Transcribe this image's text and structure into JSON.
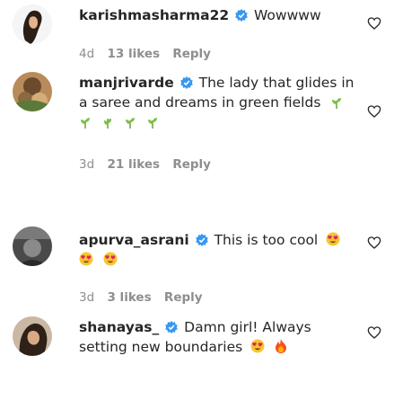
{
  "comments": [
    {
      "username": "karishmasharma22",
      "text": "Wowwww",
      "time": "4d",
      "likes": "13 likes",
      "reply": "Reply"
    },
    {
      "username": "manjrivarde",
      "text": "The lady that glides in a saree and dreams in green fields",
      "time": "3d",
      "likes": "21 likes",
      "reply": "Reply"
    },
    {
      "username": "apurva_asrani",
      "text": "This is too cool",
      "time": "3d",
      "likes": "3 likes",
      "reply": "Reply"
    },
    {
      "username": "shanayas_",
      "text": "Damn girl! Always setting new boundaries",
      "time": "",
      "likes": "",
      "reply": ""
    }
  ],
  "icons": {
    "verified": "verified-badge-icon",
    "like": "heart-outline-icon",
    "emoji_heart_eyes": "smiling-face-with-heart-eyes-emoji",
    "emoji_herb": "herb-emoji",
    "emoji_fire": "fire-emoji"
  },
  "colors": {
    "verified_blue": "#3897f0",
    "meta_gray": "#8e8e8e",
    "text": "#262626"
  }
}
